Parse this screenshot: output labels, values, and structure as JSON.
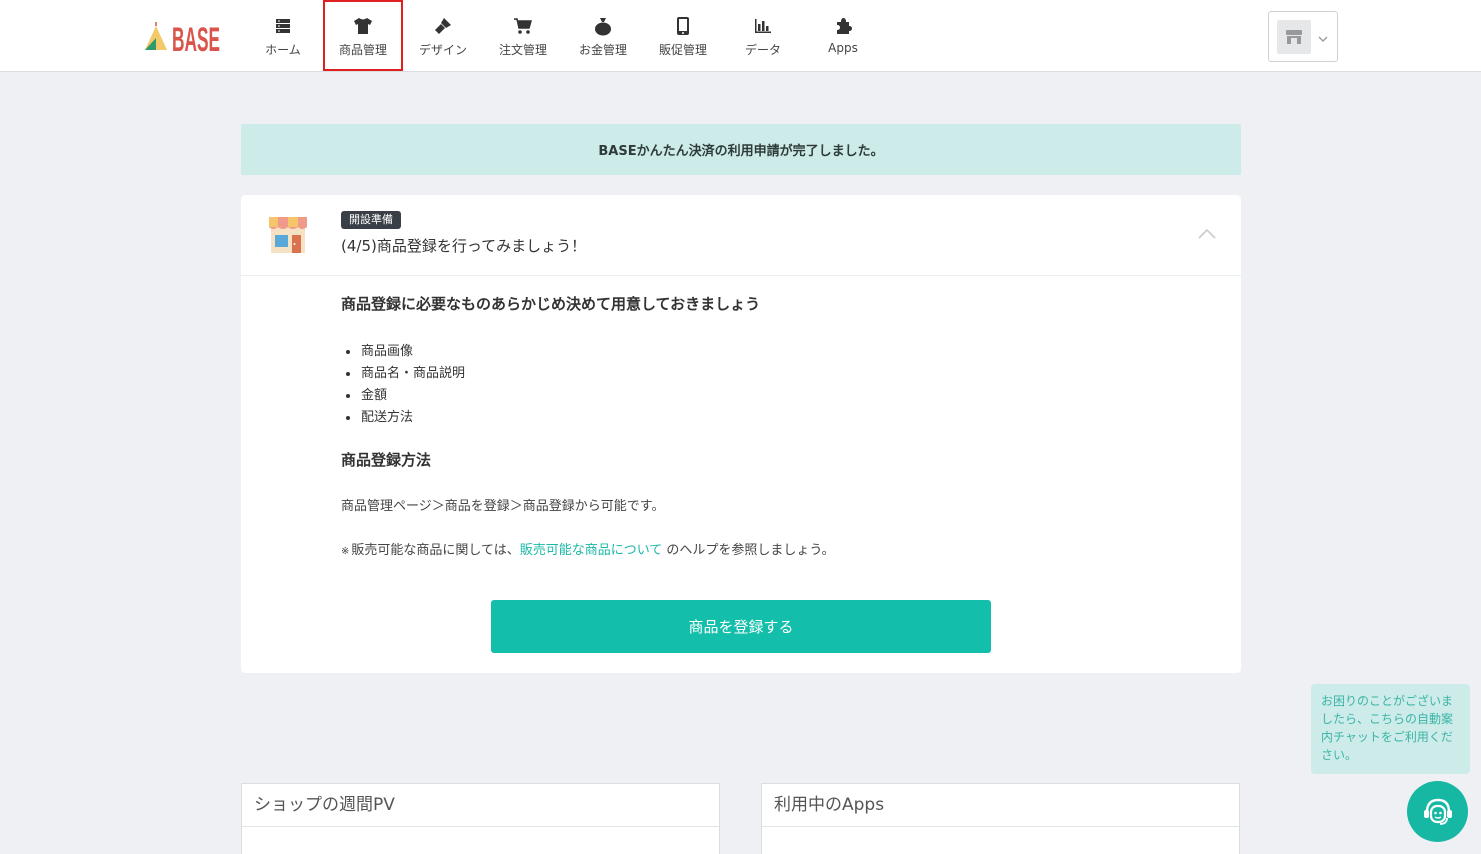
{
  "header": {
    "logo_text": "BASE",
    "nav": [
      {
        "label": "ホーム",
        "icon": "server-stack-icon"
      },
      {
        "label": "商品管理",
        "icon": "tshirt-icon"
      },
      {
        "label": "デザイン",
        "icon": "paintbrush-icon"
      },
      {
        "label": "注文管理",
        "icon": "cart-icon"
      },
      {
        "label": "お金管理",
        "icon": "money-bag-icon"
      },
      {
        "label": "販促管理",
        "icon": "smartphone-icon"
      },
      {
        "label": "データ",
        "icon": "bar-chart-icon"
      },
      {
        "label": "Apps",
        "icon": "puzzle-icon"
      }
    ],
    "active_nav": "商品管理",
    "shop_menu_icon": "storefront-icon"
  },
  "notice": {
    "text": "BASEかんたん決済の利用申請が完了しました。"
  },
  "setup_card": {
    "badge": "開設準備",
    "title": "(4/5)商品登録を行ってみましょう！",
    "heading1": "商品登録に必要なものあらかじめ決めて用意しておきましょう",
    "items": [
      "商品画像",
      "商品名・商品説明",
      "金額",
      "配送方法"
    ],
    "heading2": "商品登録方法",
    "steps_text": "商品管理ページ＞商品を登録＞商品登録から可能です。",
    "note_mark": "※",
    "note_prefix": "販売可能な商品に関しては、",
    "note_link": "販売可能な商品について",
    "note_suffix": "のヘルプを参照しましょう。",
    "button": "商品を登録する"
  },
  "panels": {
    "weekly_pv_title": "ショップの週間PV",
    "apps_title": "利用中のApps"
  },
  "chat": {
    "tip": "お困りのことがございましたら、こちらの自動案内チャットをご利用ください。"
  },
  "colors": {
    "accent": "#13bfaa",
    "notice_bg": "#cdece9",
    "active_outline": "#e01f1f"
  }
}
